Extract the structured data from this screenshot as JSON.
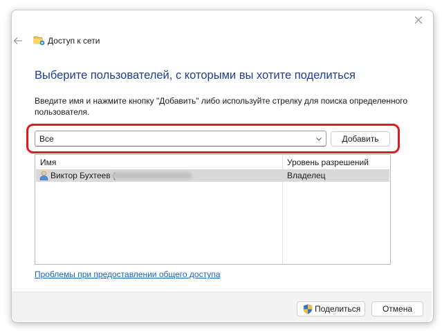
{
  "window": {
    "title": "Доступ к сети",
    "title_icon": "folder-network-icon",
    "close_icon": "close-icon",
    "back_icon": "back-arrow-icon"
  },
  "main": {
    "heading": "Выберите пользователей, с которыми вы хотите поделиться",
    "instructions": "Введите имя и нажмите кнопку \"Добавить\" либо используйте стрелку для поиска определенного пользователя.",
    "user_select_value": "Все",
    "add_button": "Добавить"
  },
  "table": {
    "columns": [
      "Имя",
      "Уровень разрешений"
    ],
    "rows": [
      {
        "name": "Виктор Бухтеев (",
        "email_blurred": true,
        "permission": "Владелец",
        "icon": "user-icon"
      }
    ]
  },
  "help_link": "Проблемы при предоставлении общего доступа",
  "footer": {
    "share_button": "Поделиться",
    "share_icon": "uac-shield-icon",
    "cancel_button": "Отмена"
  },
  "colors": {
    "heading": "#1e3f91",
    "link": "#1b63b8",
    "highlight": "#e2181c",
    "selected_row": "#d9d9d9"
  }
}
